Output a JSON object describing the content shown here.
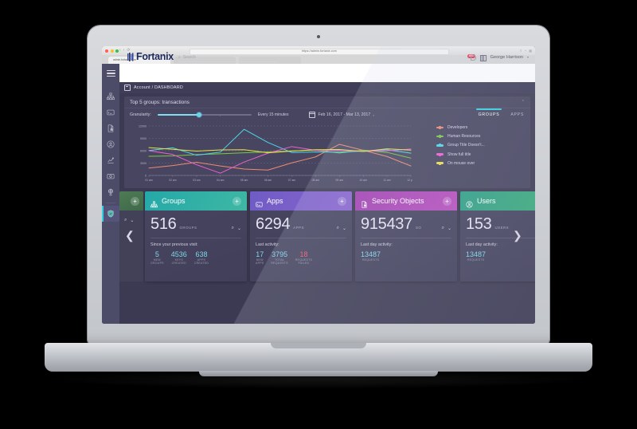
{
  "browser": {
    "url": "https://admin.fortanix.com",
    "tab_title": "admin.fortanix.com",
    "traffic_lights": [
      "close-red",
      "minimize-yellow",
      "maximize-green"
    ],
    "nav_back": "‹",
    "nav_forward": "›"
  },
  "laptop": {
    "brand": ""
  },
  "header": {
    "menu_icon": "hamburger-icon",
    "logo_text": "Fortanix",
    "search_placeholder": "Search",
    "search_icon": "search-icon",
    "notification_count": "456",
    "docs_icon": "book-icon",
    "user_name": "George Harrison",
    "user_caret": "▾"
  },
  "breadcrumb": {
    "icon": "dashboard-icon",
    "text": "Account / DASHBOARD"
  },
  "sidebar": {
    "items": [
      {
        "name": "groups",
        "icon": "org-chart-icon",
        "active": false
      },
      {
        "name": "apps",
        "icon": "app-card-icon",
        "active": false
      },
      {
        "name": "security-objects",
        "icon": "doc-lock-icon",
        "active": false
      },
      {
        "name": "users",
        "icon": "user-circle-icon",
        "active": false
      },
      {
        "name": "analytics",
        "icon": "line-chart-icon",
        "active": false
      },
      {
        "name": "plugins",
        "icon": "plugin-card-icon",
        "active": false
      },
      {
        "name": "cluster",
        "icon": "globe-icon",
        "active": false
      },
      {
        "name": "security",
        "icon": "shield-icon",
        "active": true
      }
    ]
  },
  "panel": {
    "title": "Top 5 groups: transactions",
    "collapse_icon": "chevron-up-icon",
    "granularity_label": "Granularity:",
    "granularity_value": "Every 15 minutes",
    "calendar_icon": "calendar-icon",
    "date_range": "Feb 16, 2017 - Mar 13, 2017",
    "date_caret": "▾",
    "tabs": [
      {
        "label": "GROUPS",
        "active": true
      },
      {
        "label": "APPS",
        "active": false
      }
    ]
  },
  "chart_data": {
    "type": "line",
    "title": "Top 5 groups: transactions",
    "xlabel": "",
    "ylabel": "",
    "ylim": [
      0,
      12000
    ],
    "yticks": [
      0,
      3000,
      6000,
      9000,
      12000
    ],
    "grid": true,
    "legend_position": "right",
    "categories": [
      "01 am",
      "02 am",
      "03 am",
      "04 am",
      "05 am",
      "06 am",
      "07 am",
      "08 am",
      "09 am",
      "10 am",
      "11 am",
      "12 pm"
    ],
    "series": [
      {
        "name": "Developers",
        "color": "#ef8a72",
        "values": [
          1800,
          2400,
          3200,
          2300,
          1550,
          1300,
          3050,
          4500,
          7550,
          6100,
          4600,
          2300
        ]
      },
      {
        "name": "Human Resources",
        "color": "#7ac943",
        "values": [
          4650,
          4750,
          5050,
          5250,
          5500,
          5700,
          5950,
          6150,
          5450,
          6150,
          5600,
          4200
        ]
      },
      {
        "name": "Group Title Doesn't...",
        "color": "#4fd6e8",
        "values": [
          6050,
          6700,
          4900,
          5650,
          11200,
          8000,
          5550,
          5700,
          5650,
          5900,
          6250,
          5400
        ]
      },
      {
        "name": "Show full title",
        "color": "#f05fd0",
        "values": [
          6000,
          5100,
          2600,
          550,
          3250,
          5400,
          7000,
          6100,
          6100,
          5850,
          6000,
          6400
        ]
      },
      {
        "name": "On mouse over",
        "color": "#e8e14a",
        "values": [
          6750,
          6350,
          5900,
          6200,
          6250,
          5500,
          5900,
          6250,
          6300,
          5800,
          6450,
          6150
        ]
      }
    ]
  },
  "cards": {
    "left_partial": {
      "title": "",
      "plus": "+",
      "search_icon": "search-icon",
      "caret": "▾",
      "header_color": "#4f7a55"
    },
    "prev_arrow": "❮",
    "next_arrow": "❯",
    "items": [
      {
        "title": "Groups",
        "icon": "org-chart-icon",
        "header_color": "#24a8a8",
        "header_color2": "#3fb8a4",
        "plus": "+",
        "count": "516",
        "count_unit": "GROUPS",
        "search_icon": "search-icon",
        "caret": "▾",
        "sub_label": "Since your previous visit:",
        "stats": [
          {
            "value": "5",
            "label": "NEW GROUPS",
            "accent": "#7fd6e8"
          },
          {
            "value": "4536",
            "label": "KEYS CREATED",
            "accent": "#7fd6e8"
          },
          {
            "value": "638",
            "label": "APPS CREATED",
            "accent": "#7fd6e8"
          }
        ]
      },
      {
        "title": "Apps",
        "icon": "app-card-icon",
        "header_color": "#6e5cc4",
        "header_color2": "#8a63cf",
        "plus": "+",
        "count": "6294",
        "count_unit": "APPS",
        "search_icon": "search-icon",
        "caret": "▾",
        "sub_label": "Last activity:",
        "stats": [
          {
            "value": "17",
            "label": "NEW APPS",
            "accent": "#7fd6e8"
          },
          {
            "value": "3795",
            "label": "TOTAL REQUESTS",
            "accent": "#7fd6e8"
          },
          {
            "value": "18",
            "label": "REQUESTS FAILED",
            "accent": "#f2566f"
          }
        ]
      },
      {
        "title": "Security Objects",
        "icon": "doc-lock-icon",
        "header_color": "#a13fb0",
        "header_color2": "#b94fbf",
        "plus": "+",
        "count": "915437",
        "count_unit": "SO",
        "search_icon": "search-icon",
        "caret": "▾",
        "sub_label": "Last day activity:",
        "stats": [
          {
            "value": "13487",
            "label": "REQUESTS",
            "accent": "#7fd6e8"
          }
        ]
      },
      {
        "title": "Users",
        "icon": "user-circle-icon",
        "header_color": "#2e9f86",
        "header_color2": "#3fae78",
        "plus": "+",
        "count": "153",
        "count_unit": "USERS",
        "search_icon": "search-icon",
        "caret": "▾",
        "sub_label": "Last day activity:",
        "stats": [
          {
            "value": "13487",
            "label": "REQUESTS",
            "accent": "#7fd6e8"
          }
        ]
      }
    ]
  }
}
